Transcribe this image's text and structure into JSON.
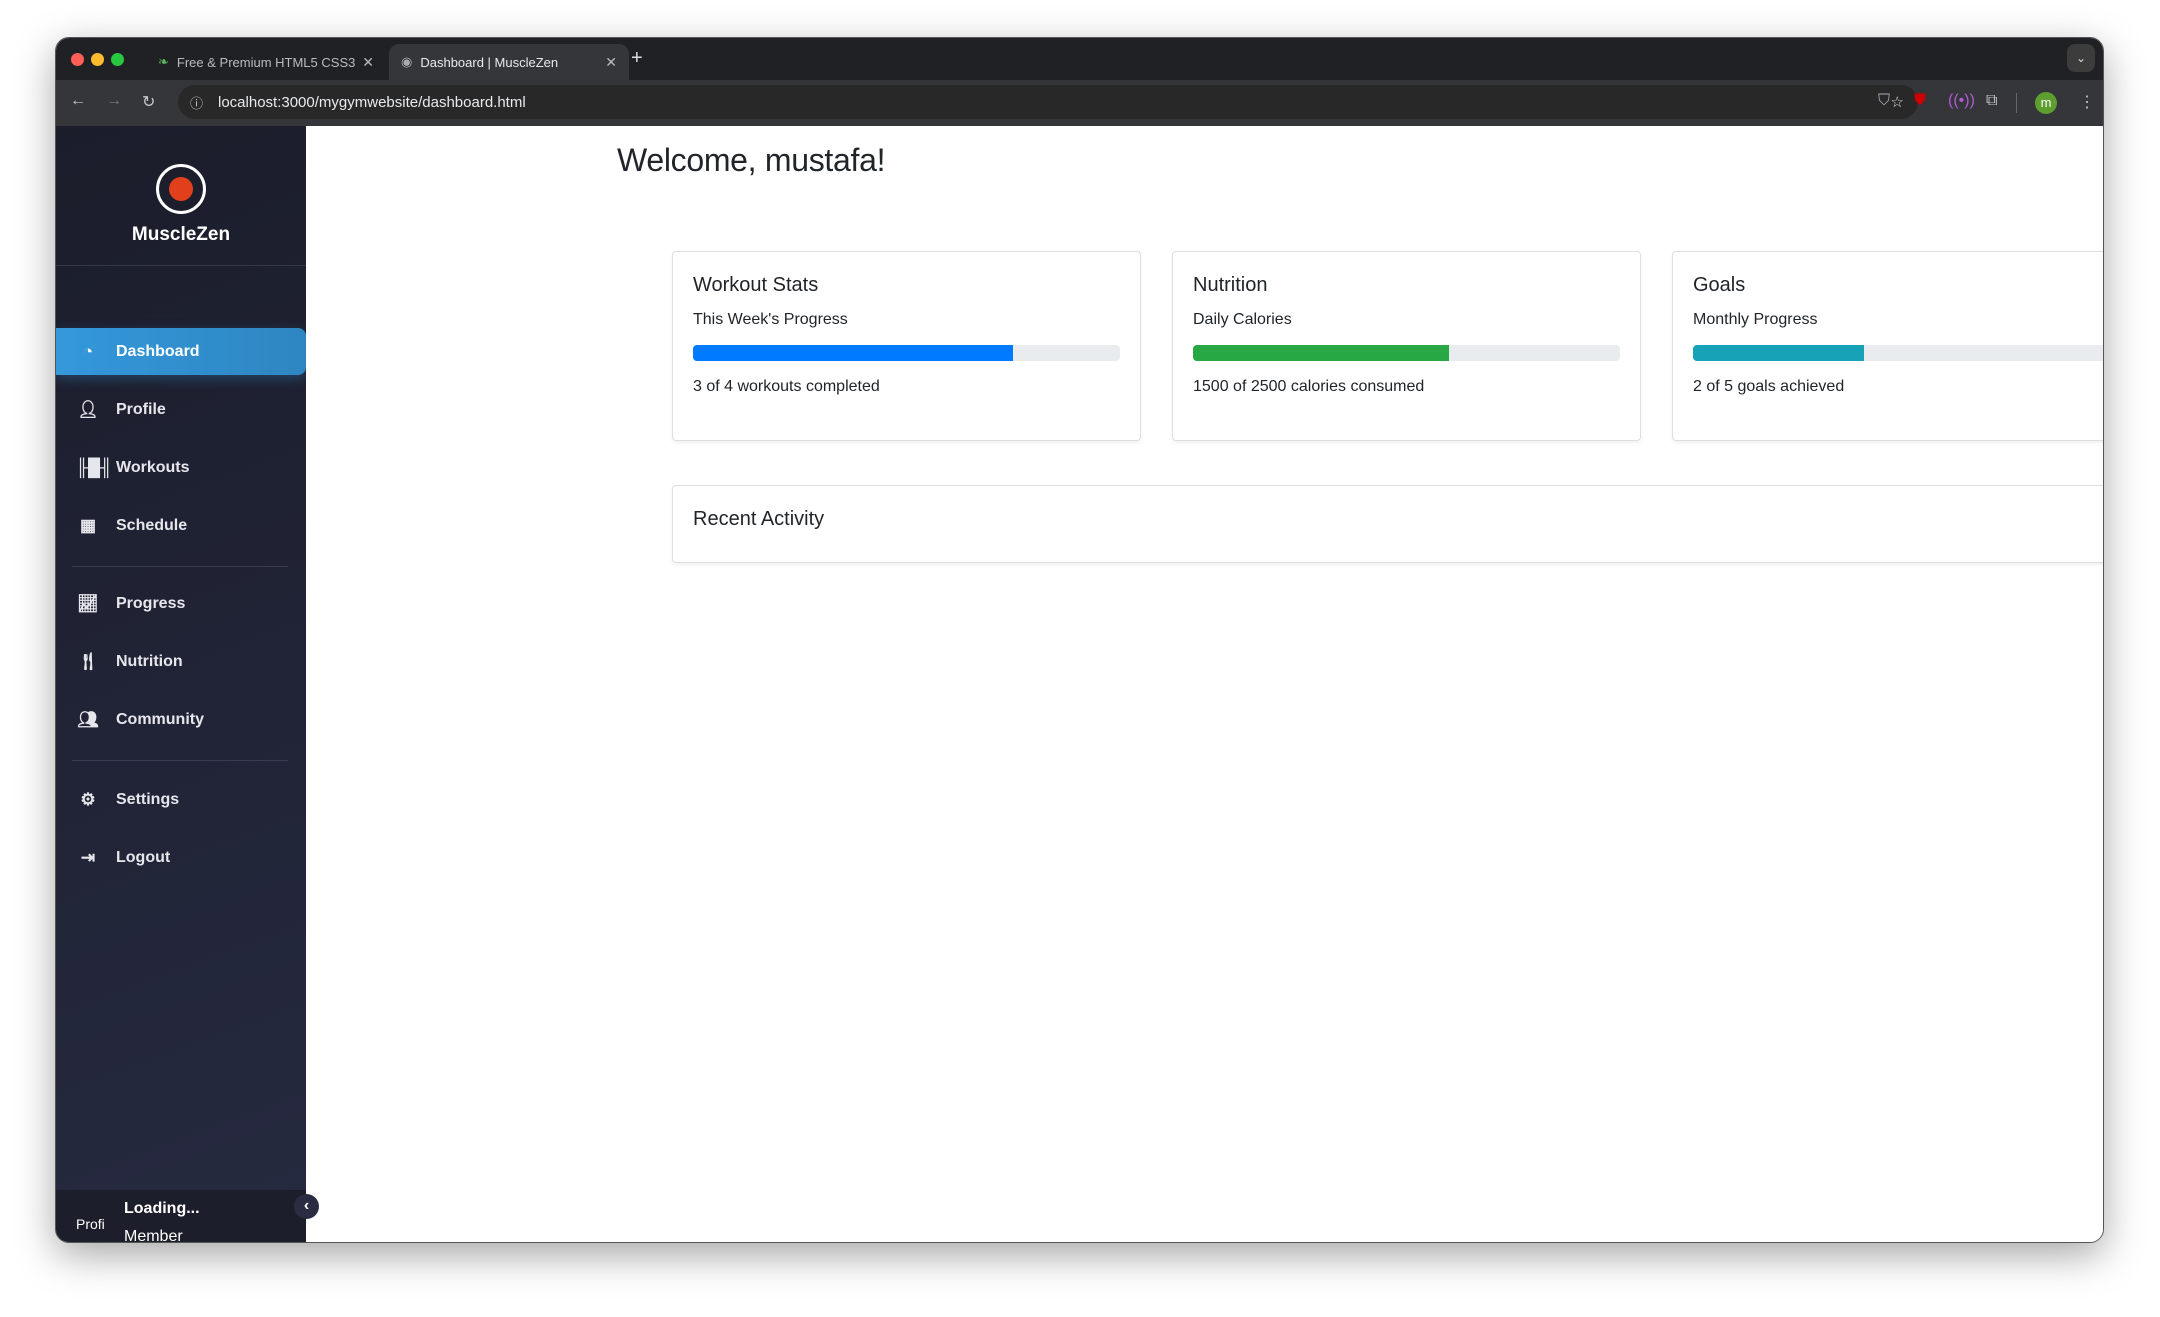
{
  "browser": {
    "tabs": [
      {
        "label": "Free & Premium HTML5 CSS3",
        "active": false
      },
      {
        "label": "Dashboard | MuscleZen",
        "active": true
      }
    ],
    "url": "localhost:3000/mygymwebsite/dashboard.html",
    "profile_initial": "m"
  },
  "sidebar": {
    "brand": "MuscleZen",
    "items": [
      {
        "label": "Dashboard",
        "icon": "gauge-icon"
      },
      {
        "label": "Profile",
        "icon": "user-icon"
      },
      {
        "label": "Workouts",
        "icon": "dumbbell-icon"
      },
      {
        "label": "Schedule",
        "icon": "calendar-icon"
      },
      {
        "label": "Progress",
        "icon": "chart-line-icon"
      },
      {
        "label": "Nutrition",
        "icon": "utensils-icon"
      },
      {
        "label": "Community",
        "icon": "users-icon"
      },
      {
        "label": "Settings",
        "icon": "gear-icon"
      },
      {
        "label": "Logout",
        "icon": "sign-out-icon"
      }
    ],
    "active": "Dashboard",
    "user": {
      "avatar_alt": "Profi",
      "name": "Loading...",
      "role": "Member"
    }
  },
  "main": {
    "title": "Welcome, mustafa!",
    "cards": [
      {
        "title": "Workout Stats",
        "subtitle": "This Week's Progress",
        "progress": 75,
        "color": "#007bff",
        "text": "3 of 4 workouts completed"
      },
      {
        "title": "Nutrition",
        "subtitle": "Daily Calories",
        "progress": 60,
        "color": "#28a745",
        "text": "1500 of 2500 calories consumed"
      },
      {
        "title": "Goals",
        "subtitle": "Monthly Progress",
        "progress": 40,
        "color": "#17a2b8",
        "text": "2 of 5 goals achieved"
      }
    ],
    "recent_activity": {
      "title": "Recent Activity"
    }
  }
}
